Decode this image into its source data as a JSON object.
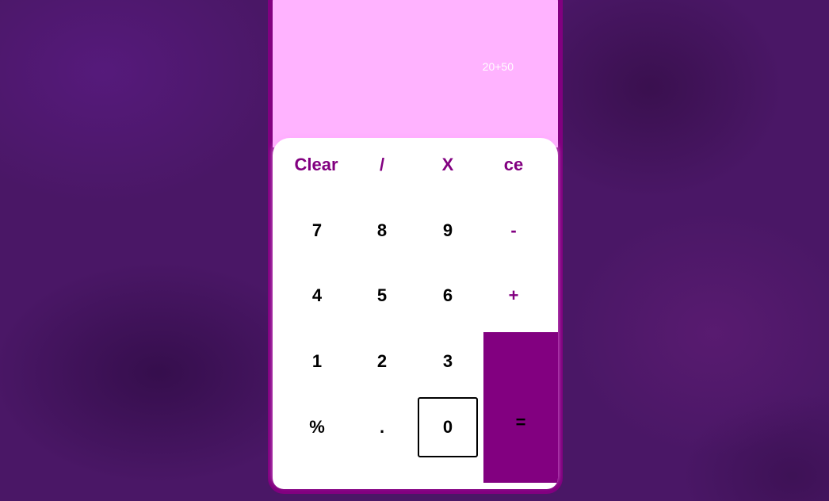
{
  "display": {
    "expression": "20+50"
  },
  "keys": {
    "clear": "Clear",
    "divide": "/",
    "multiply": "X",
    "ce": "ce",
    "seven": "7",
    "eight": "8",
    "nine": "9",
    "minus": "-",
    "four": "4",
    "five": "5",
    "six": "6",
    "plus": "+",
    "one": "1",
    "two": "2",
    "three": "3",
    "percent": "%",
    "dot": ".",
    "zero": "0",
    "equals": "="
  },
  "colors": {
    "accent": "#820080",
    "display_bg": "#ffb3ff",
    "keypad_bg": "#ffffff",
    "page_bg": "#4a1766"
  }
}
